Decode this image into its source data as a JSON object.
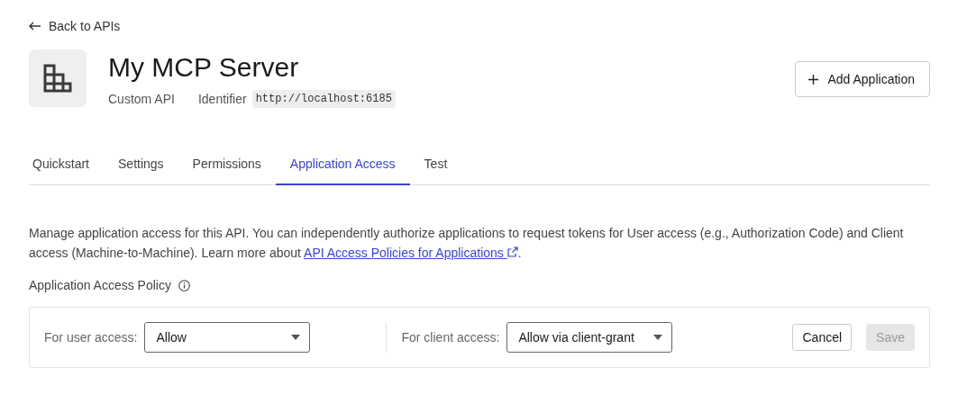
{
  "back_link": {
    "label": "Back to APIs"
  },
  "header": {
    "title": "My MCP Server",
    "type": "Custom API",
    "identifier_label": "Identifier",
    "identifier": "http://localhost:6185",
    "action": "Add Application"
  },
  "tabs": [
    {
      "label": "Quickstart",
      "selected": false
    },
    {
      "label": "Settings",
      "selected": false
    },
    {
      "label": "Permissions",
      "selected": false
    },
    {
      "label": "Application Access",
      "selected": true
    },
    {
      "label": "Test",
      "selected": false
    }
  ],
  "description": {
    "text": "Manage application access for this API. You can independently authorize applications to request tokens for User access (e.g., Authorization Code) and Client access (Machine-to-Machine). Learn more about ",
    "link": "API Access Policies for Applications",
    "after": "."
  },
  "policy": {
    "title": "Application Access Policy",
    "user_access": {
      "label": "For user access:",
      "value": "Allow"
    },
    "client_access": {
      "label": "For client access:",
      "value": "Allow via client-grant"
    },
    "buttons": [
      {
        "label": "Cancel",
        "disabled": false
      },
      {
        "label": "Save",
        "disabled": true
      }
    ]
  }
}
